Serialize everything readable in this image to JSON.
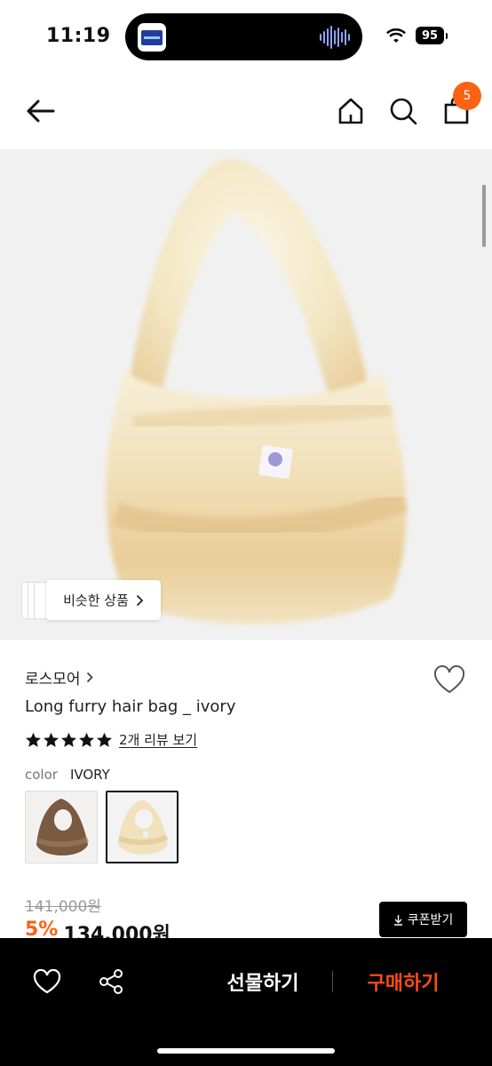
{
  "status_bar": {
    "time": "11:19",
    "battery": "95"
  },
  "nav": {
    "cart_count": "5"
  },
  "image": {
    "similar_label": "비슷한 상품"
  },
  "product": {
    "brand": "로스모어",
    "name": "Long furry hair bag _ ivory",
    "rating": 5,
    "review_link": "2개 리뷰 보기",
    "color_label": "color",
    "color_value": "IVORY",
    "swatches": [
      {
        "name": "brown",
        "selected": false
      },
      {
        "name": "ivory",
        "selected": true
      }
    ],
    "original_price": "141,000원",
    "discount_rate": "5%",
    "sale_price": "134,000원",
    "coupon_label": "쿠폰받기"
  },
  "bottom_bar": {
    "gift_label": "선물하기",
    "buy_label": "구매하기"
  },
  "colors": {
    "accent": "#fc6212",
    "buy": "#ff4b13",
    "bottom_bar": "#000000"
  },
  "icons": [
    "back-arrow-icon",
    "home-icon",
    "search-icon",
    "shopping-bag-icon",
    "heart-icon",
    "star-icon",
    "chevron-right-icon",
    "download-icon",
    "share-icon",
    "wifi-icon",
    "battery-icon"
  ]
}
